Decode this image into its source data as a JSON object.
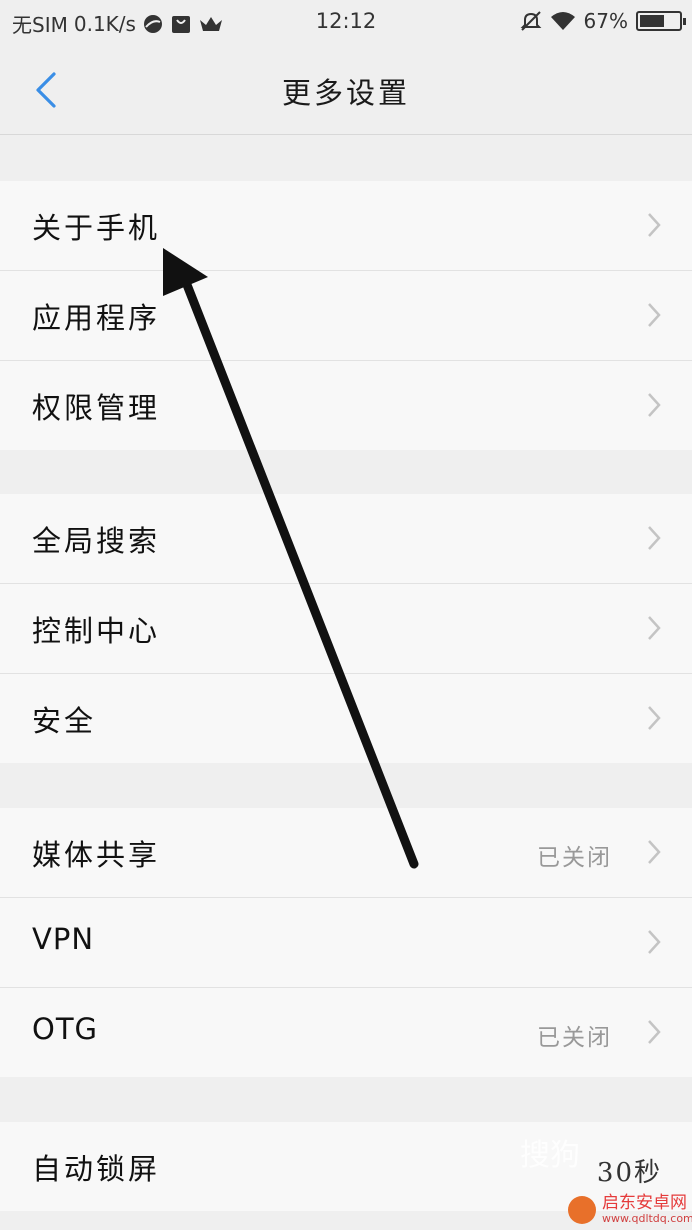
{
  "status_bar": {
    "carrier": "无SIM",
    "speed": "0.1K/s",
    "time": "12:12",
    "battery_text": "67%",
    "battery_level": 0.67
  },
  "header": {
    "title": "更多设置",
    "back_icon": "chevron-left-icon"
  },
  "groups": [
    {
      "items": [
        {
          "label": "关于手机"
        },
        {
          "label": "应用程序"
        },
        {
          "label": "权限管理"
        }
      ]
    },
    {
      "items": [
        {
          "label": "全局搜索"
        },
        {
          "label": "控制中心"
        },
        {
          "label": "安全"
        }
      ]
    },
    {
      "items": [
        {
          "label": "媒体共享",
          "value": "已关闭"
        },
        {
          "label": "VPN"
        },
        {
          "label": "OTG",
          "value": "已关闭"
        }
      ]
    },
    {
      "items": [
        {
          "label": "自动锁屏",
          "value": "30秒"
        }
      ]
    }
  ],
  "colors": {
    "accent": "#3a8ee6",
    "background": "#efefef",
    "row_bg": "#f8f8f8",
    "chevron": "#c4c4c4",
    "annotation_arrow": "#111111"
  },
  "watermark": {
    "text1": "搜狗",
    "text2": "启东安卓网",
    "text3": "www.qdltdq.com"
  }
}
